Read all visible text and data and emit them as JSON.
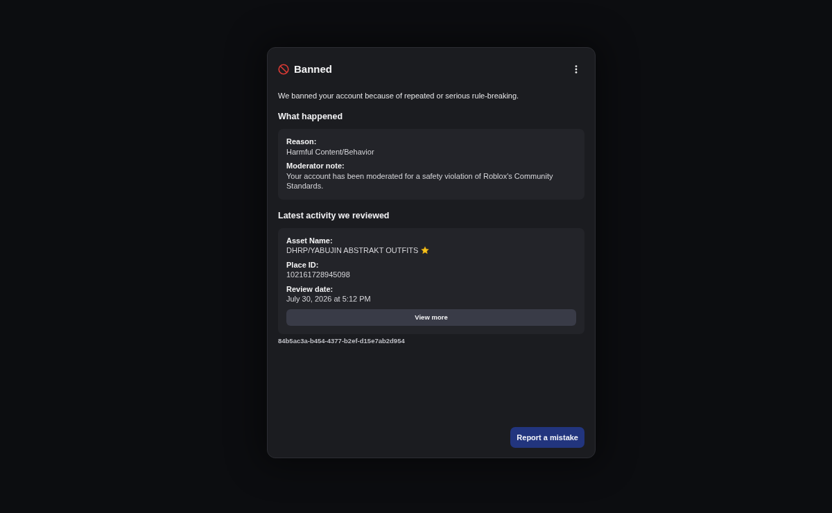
{
  "dialog": {
    "title": "Banned",
    "message": "We banned your account because of repeated or serious rule-breaking.",
    "sections": [
      {
        "heading": "What happened",
        "fields": [
          {
            "label": "Reason:",
            "value": "Harmful Content/Behavior",
            "kind": "plain"
          },
          {
            "label": "Moderator note:",
            "value": "Your account has been moderated for a safety violation of Roblox's Community Standards.",
            "kind": "plain"
          }
        ]
      },
      {
        "heading": "Latest activity we reviewed",
        "fields": [
          {
            "label": "Asset Name:",
            "value": "DHRP/YABUJIN ABSTRAKT OUTFITS",
            "kind": "starred"
          },
          {
            "label": "Place ID:",
            "value": "102161728945098",
            "kind": "plain"
          },
          {
            "label": "Review date:",
            "value": "July 30, 2026 at 5:12 PM",
            "kind": "plain"
          }
        ],
        "button": "View more"
      }
    ],
    "reference_id": "84b5ac3a-b454-4377-b2ef-d15e7ab2d954",
    "action_button": "Report a mistake"
  }
}
